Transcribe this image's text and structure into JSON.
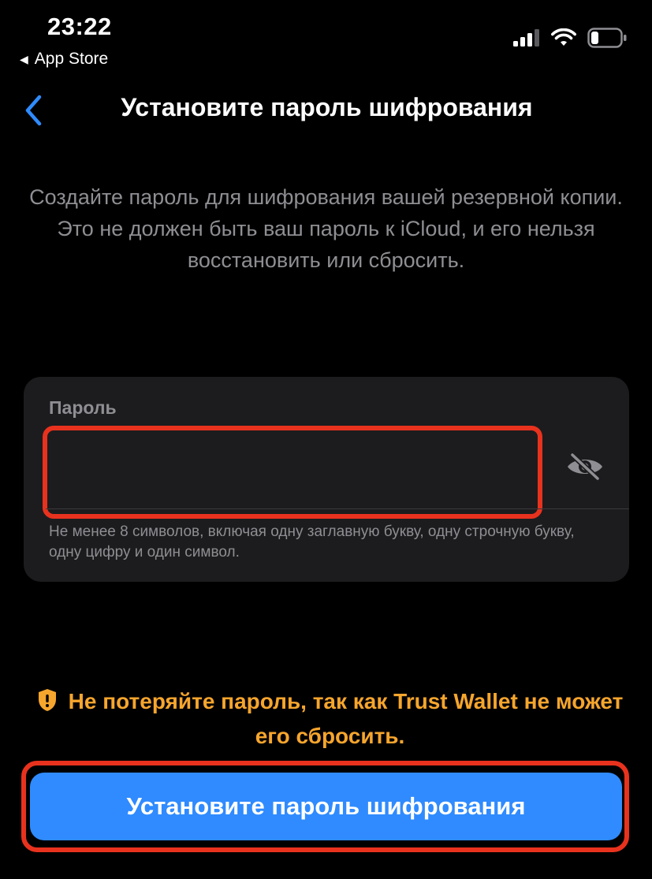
{
  "status_bar": {
    "time": "23:22",
    "back_app_label": "App Store"
  },
  "nav": {
    "title": "Установите пароль шифрования",
    "back_icon": "chevron-left-icon"
  },
  "description": "Создайте пароль для шифрования вашей резервной копии. Это не должен быть ваш пароль к iCloud, и его нельзя восстановить или сбросить.",
  "password_field": {
    "label": "Пароль",
    "value": "",
    "placeholder": "",
    "toggle_icon": "eye-slash-icon",
    "hint": "Не менее 8 символов, включая одну заглавную букву, одну строчную букву, одну цифру и один символ."
  },
  "warning": {
    "icon": "shield-exclamation-icon",
    "text": "Не потеряйте пароль, так как Trust Wallet не может его сбросить."
  },
  "cta": {
    "label": "Установите пароль шифрования"
  },
  "colors": {
    "background": "#000000",
    "card": "#1c1c1e",
    "accent_blue": "#2f8bff",
    "warning_orange": "#f6a52d",
    "highlight_red": "#e8321e",
    "secondary_text": "#8e8e93"
  }
}
